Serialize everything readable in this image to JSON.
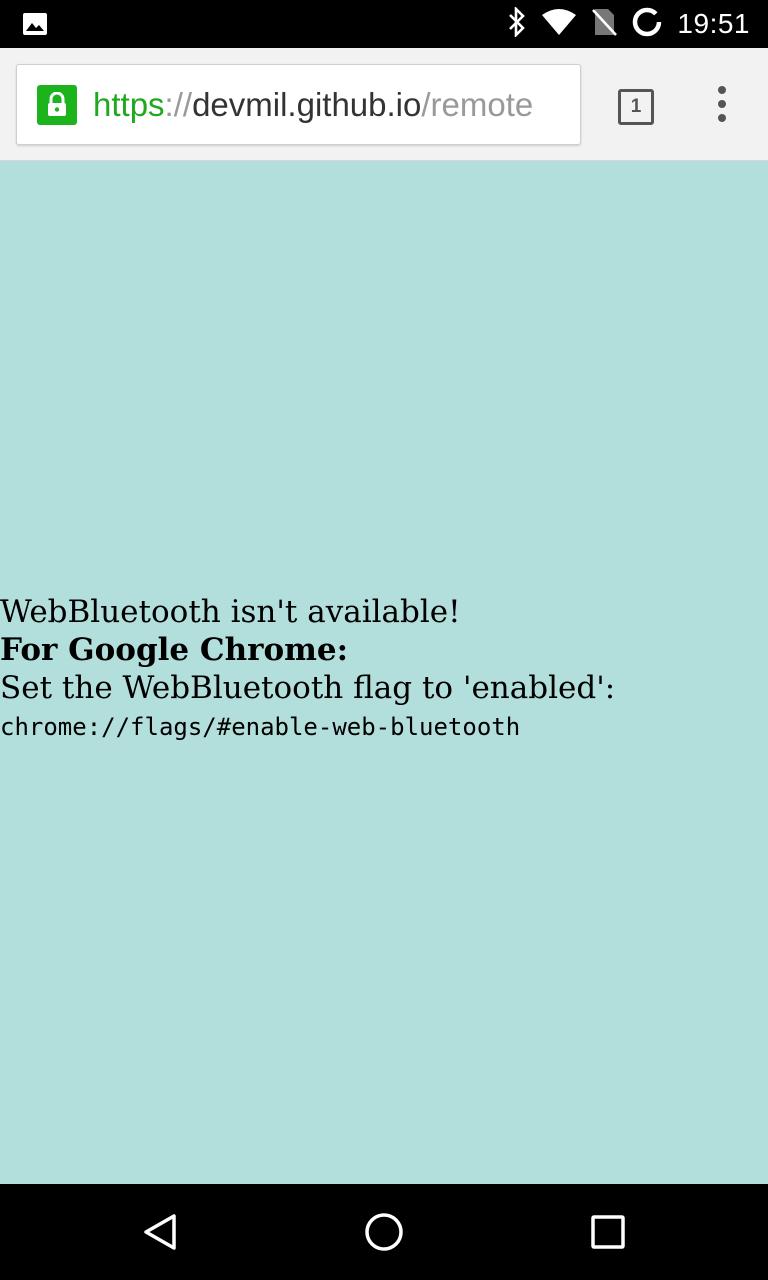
{
  "status_bar": {
    "time": "19:51",
    "icons": [
      "image-notification-icon",
      "bluetooth-icon",
      "wifi-icon",
      "no-sim-icon",
      "sync-icon"
    ]
  },
  "toolbar": {
    "url_scheme": "https",
    "url_separator": "://",
    "url_host": "devmil.github.io",
    "url_path": "/remote",
    "tab_count": "1",
    "lock_color": "#1db31d"
  },
  "page": {
    "background": "#b2dfdb",
    "line1": "WebBluetooth isn't available!",
    "line2": "For Google Chrome:",
    "line3": "Set the WebBluetooth flag to 'enabled':",
    "line4": "chrome://flags/#enable-web-bluetooth"
  },
  "nav_bar": {
    "icons": [
      "back-icon",
      "home-icon",
      "recents-icon"
    ]
  }
}
